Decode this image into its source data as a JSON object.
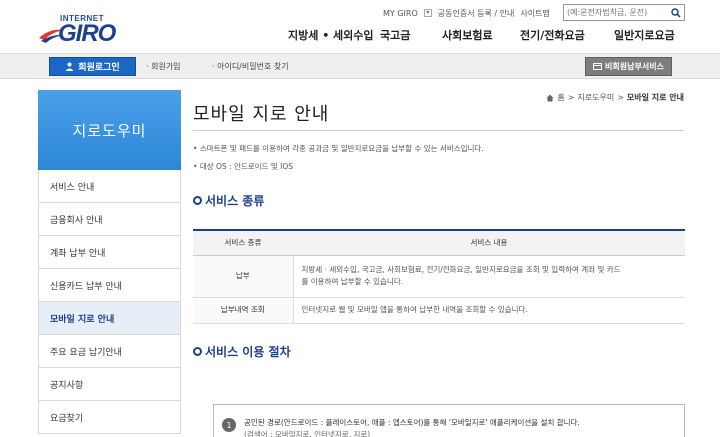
{
  "header": {
    "logo_small": "INTERNET",
    "logo_big": "GIRO",
    "util": [
      "MY GIRO",
      "공동인증서 등록 / 안내",
      "사이트맵"
    ],
    "search_placeholder": "(예:운전자범칙금, 운전)",
    "gnb": [
      "지방세 • 세외수입",
      "국고금",
      "사회보험료",
      "전기/전화요금",
      "일반지로요금"
    ]
  },
  "bar": {
    "login": "회원로그인",
    "join": "회원가입",
    "find": "아이디/비밀번호 찾기",
    "nonmember": "비회원납부서비스"
  },
  "sidebar": {
    "title": "지로도우미",
    "items": [
      {
        "label": "서비스 안내"
      },
      {
        "label": "금융회사 안내"
      },
      {
        "label": "계좌 납부 안내"
      },
      {
        "label": "신용카드 납부 안내"
      },
      {
        "label": "모바일 지로 안내",
        "active": true
      },
      {
        "label": "주요 요금 납기안내"
      },
      {
        "label": "공지사항"
      },
      {
        "label": "요금찾기"
      }
    ]
  },
  "breadcrumb": {
    "home": "홈",
    "level1": "지로도우미",
    "current": "모바일 지로 안내"
  },
  "main": {
    "title": "모바일 지로 안내",
    "bullets": [
      "스마트폰 및 패드를 이용하여 각종 공과금 및 일반지로요금을 납부할 수 있는 서비스입니다.",
      "대상 OS : 안드로이드 및 IOS"
    ],
    "section1": "서비스 종류",
    "table": {
      "headers": [
        "서비스 종류",
        "서비스 내용"
      ],
      "rows": [
        {
          "k": "납부",
          "v1": "지방세 · 세외수입, 국고금, 사회보험료, 전기/전화요금, 일반지로요금을 조회 및 입력하여 계좌 및 카드",
          "v2": "를 이용하여 납부할 수 있습니다."
        },
        {
          "k": "납부내역 조회",
          "v1": "인터넷지로 웹 및 모바일 앱을 통하여 납부한 내역을 조회할 수 있습니다.",
          "v2": ""
        }
      ]
    },
    "section2": "서비스 이용 절차",
    "step": {
      "num": "1",
      "line1": "공인된 경로(안드로이드 : 플레이스토어, 애플 : 앱스토어)를 통해 '모바일지로' 애플리케이션을 설치 합니다.",
      "line2": "(검색어 : 모바일지로, 인터넷지로, 지로)"
    }
  }
}
